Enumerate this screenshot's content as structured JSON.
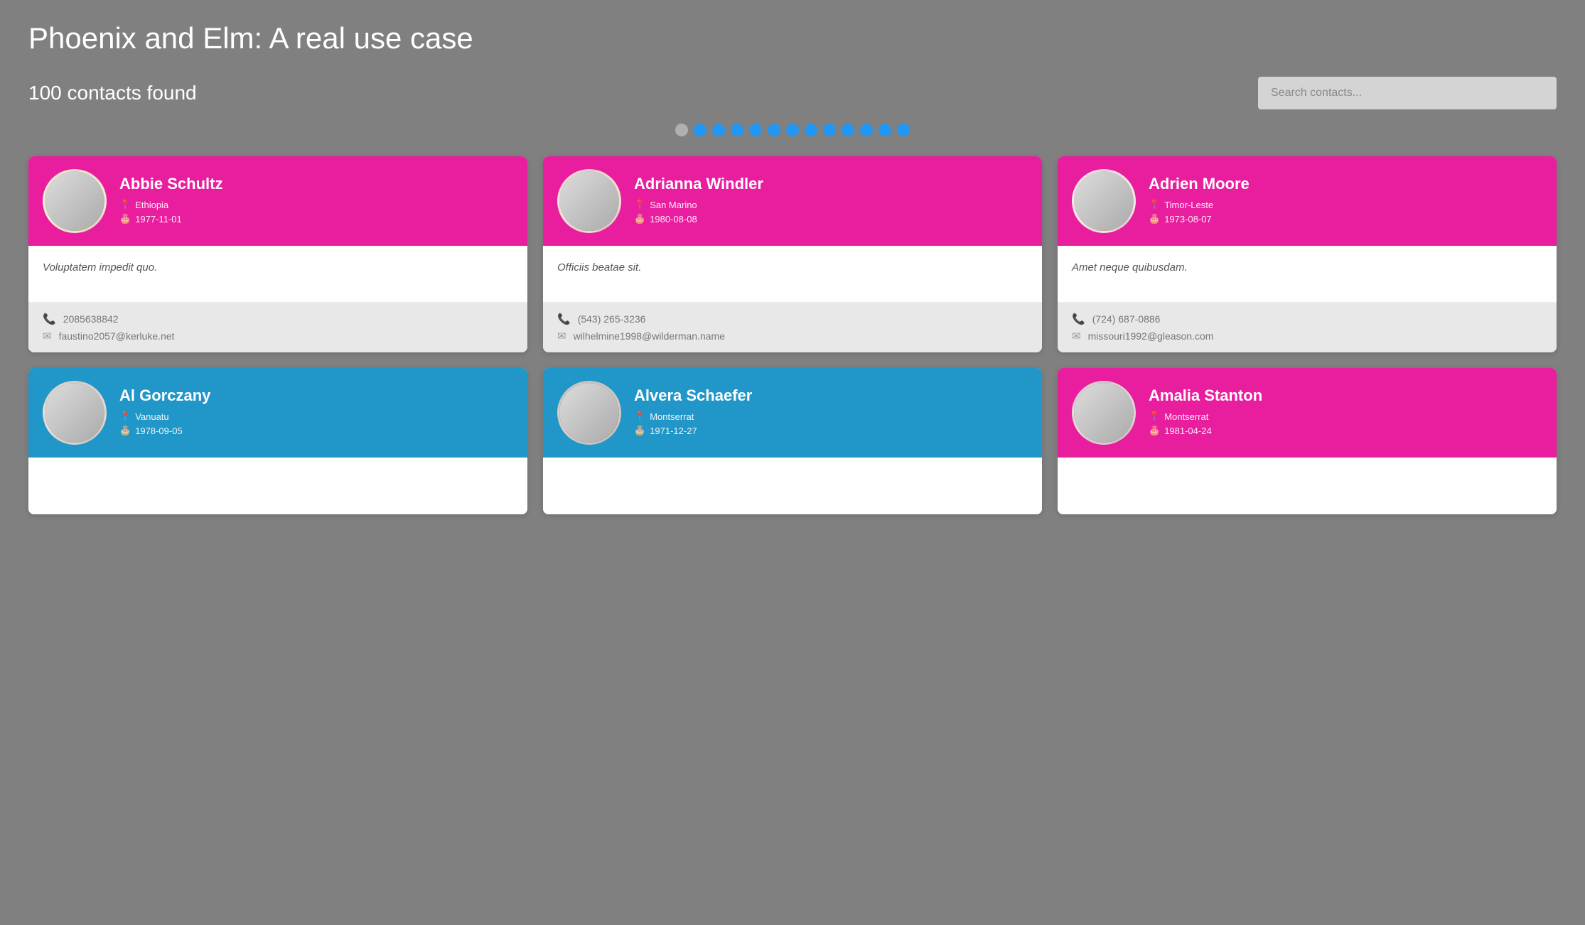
{
  "page": {
    "title": "Phoenix and Elm: A real use case",
    "contacts_found": "100 contacts found"
  },
  "search": {
    "placeholder": "Search contacts..."
  },
  "pagination": {
    "dots": [
      {
        "active": false
      },
      {
        "active": true
      },
      {
        "active": true
      },
      {
        "active": true
      },
      {
        "active": true
      },
      {
        "active": true
      },
      {
        "active": true
      },
      {
        "active": true
      },
      {
        "active": true
      },
      {
        "active": true
      },
      {
        "active": true
      },
      {
        "active": true
      },
      {
        "active": true
      }
    ]
  },
  "contacts": [
    {
      "name": "Abbie Schultz",
      "location": "Ethiopia",
      "dob": "1977-11-01",
      "bio": "Voluptatem impedit quo.",
      "phone": "2085638842",
      "email": "faustino2057@kerluke.net",
      "color": "pink",
      "avatar_class": "avatar-abbie"
    },
    {
      "name": "Adrianna Windler",
      "location": "San Marino",
      "dob": "1980-08-08",
      "bio": "Officiis beatae sit.",
      "phone": "(543) 265-3236",
      "email": "wilhelmine1998@wilderman.name",
      "color": "pink",
      "avatar_class": "avatar-adrianna"
    },
    {
      "name": "Adrien Moore",
      "location": "Timor-Leste",
      "dob": "1973-08-07",
      "bio": "Amet neque quibusdam.",
      "phone": "(724) 687-0886",
      "email": "missouri1992@gleason.com",
      "color": "pink",
      "avatar_class": "avatar-adrien"
    },
    {
      "name": "Al Gorczany",
      "location": "Vanuatu",
      "dob": "1978-09-05",
      "bio": "",
      "phone": "",
      "email": "",
      "color": "blue",
      "avatar_class": "avatar-al"
    },
    {
      "name": "Alvera Schaefer",
      "location": "Montserrat",
      "dob": "1971-12-27",
      "bio": "",
      "phone": "",
      "email": "",
      "color": "blue",
      "avatar_class": "avatar-alvera"
    },
    {
      "name": "Amalia Stanton",
      "location": "Montserrat",
      "dob": "1981-04-24",
      "bio": "",
      "phone": "",
      "email": "",
      "color": "pink",
      "avatar_class": "avatar-amalia"
    }
  ]
}
